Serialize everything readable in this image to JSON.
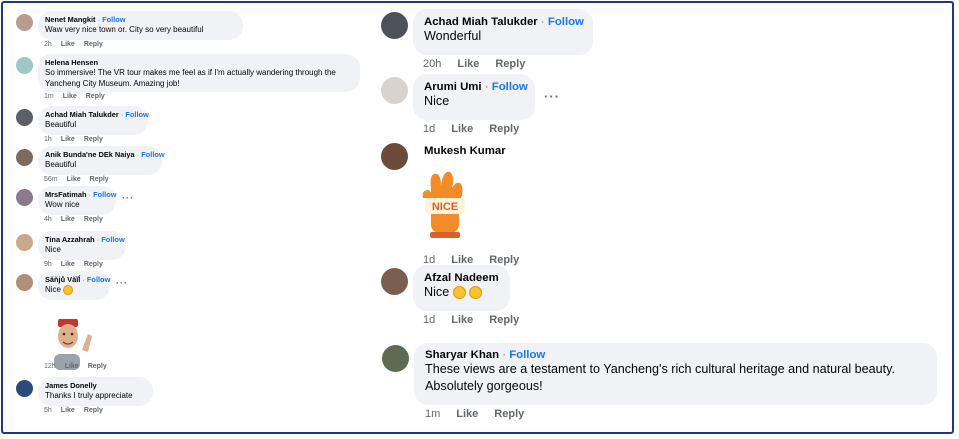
{
  "left": [
    {
      "name": "Nenet Mangkit",
      "follow": "Follow",
      "text": "Waw very nice town or. City so very beautiful",
      "time": "2h",
      "like": "Like",
      "reply": "Reply",
      "avatar": "#b89c8e"
    },
    {
      "name": "Helena Hensen",
      "follow": "",
      "text": "So immersive! The VR tour makes me feel as if I'm actually wandering through the Yancheng City Museum. Amazing job!",
      "time": "1m",
      "like": "Like",
      "reply": "Reply",
      "avatar": "#9ec7c9"
    },
    {
      "name": "Achad Miah Talukder",
      "follow": "Follow",
      "text": "Beautiful",
      "time": "1h",
      "like": "Like",
      "reply": "Reply",
      "avatar": "#5a5f68"
    },
    {
      "name": "Anik Bunda'ne DEk Naiya",
      "follow": "Follow",
      "text": "Beautiful",
      "time": "56m",
      "like": "Like",
      "reply": "Reply",
      "avatar": "#7d6b5e"
    },
    {
      "name": "MrsFatimah",
      "follow": "Follow",
      "text": "Wow nice",
      "time": "4h",
      "like": "Like",
      "reply": "Reply",
      "avatar": "#8b7a8a"
    },
    {
      "name": "Tina Azzahrah",
      "follow": "Follow",
      "text": "Nice",
      "time": "9h",
      "like": "Like",
      "reply": "Reply",
      "avatar": "#c9a98a"
    },
    {
      "name": "Săňjů Văĩĺ",
      "follow": "Follow",
      "text": "Nice",
      "time": "",
      "like": "",
      "reply": "",
      "avatar": "#b08f7a"
    },
    {
      "name": "",
      "follow": "",
      "text": "",
      "time": "12h",
      "like": "Like",
      "reply": "Reply",
      "avatar": ""
    },
    {
      "name": "James Donelly",
      "follow": "",
      "text": "Thanks I truly appreciate",
      "time": "5h",
      "like": "Like",
      "reply": "Reply",
      "avatar": "#2c4a7a"
    }
  ],
  "right": [
    {
      "name": "Achad Miah Talukder",
      "follow": "Follow",
      "text": "Wonderful",
      "time": "20h",
      "like": "Like",
      "reply": "Reply",
      "avatar": "#4d525a"
    },
    {
      "name": "Arumi Umi",
      "follow": "Follow",
      "text": "Nice",
      "time": "1d",
      "like": "Like",
      "reply": "Reply",
      "avatar": "#d9d3cf"
    },
    {
      "name": "Mukesh Kumar",
      "follow": "",
      "text": "",
      "time": "1d",
      "like": "Like",
      "reply": "Reply",
      "avatar": "#6b4a3a",
      "sticker_text": "NICE"
    },
    {
      "name": "Afzal Nadeem",
      "follow": "Follow",
      "text": "Nice",
      "time": "1d",
      "like": "Like",
      "reply": "Reply",
      "avatar": "#7a5e4e"
    },
    {
      "name": "Sharyar Khan",
      "follow": "Follow",
      "text": "These views are a testament to Yancheng's rich cultural heritage and natural beauty. Absolutely gorgeous!",
      "time": "1m",
      "like": "Like",
      "reply": "Reply",
      "avatar": "#5d6b52"
    }
  ],
  "dot": "·",
  "more": "···",
  "colors": {
    "follow": "#1877f2",
    "bubble": "#f0f2f5",
    "meta": "#65676b",
    "frame": "#1f3a78"
  },
  "icons": {
    "more": "more-options-icon",
    "emoji": "smiley-emoji-icon",
    "sticker": "nice-sticker",
    "avatar_sticker": "memoji-avatar-sticker"
  }
}
